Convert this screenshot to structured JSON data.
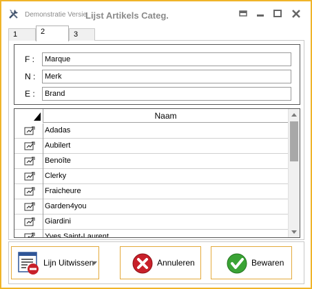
{
  "titlebar": {
    "version_text": "Demonstratie Versie",
    "title": "Lijst Artikels Categ."
  },
  "tabs": [
    {
      "label": "1"
    },
    {
      "label": "2"
    },
    {
      "label": "3"
    }
  ],
  "fields": [
    {
      "label": "F :",
      "value": "Marque"
    },
    {
      "label": "N :",
      "value": "Merk"
    },
    {
      "label": "E :",
      "value": "Brand"
    }
  ],
  "grid": {
    "column_header": "Naam",
    "rows": [
      "Adadas",
      "Aubilert",
      "Benoîte",
      "Clerky",
      "Fraicheure",
      "Garden4you",
      "Giardini",
      "Yves Saint-Laurent"
    ]
  },
  "buttons": {
    "delete_line": "Lijn Uitwissen",
    "cancel": "Annuleren",
    "save": "Bewaren"
  },
  "colors": {
    "accent_border": "#f0b429",
    "cancel_red": "#c8202a",
    "save_green": "#3aa335"
  }
}
